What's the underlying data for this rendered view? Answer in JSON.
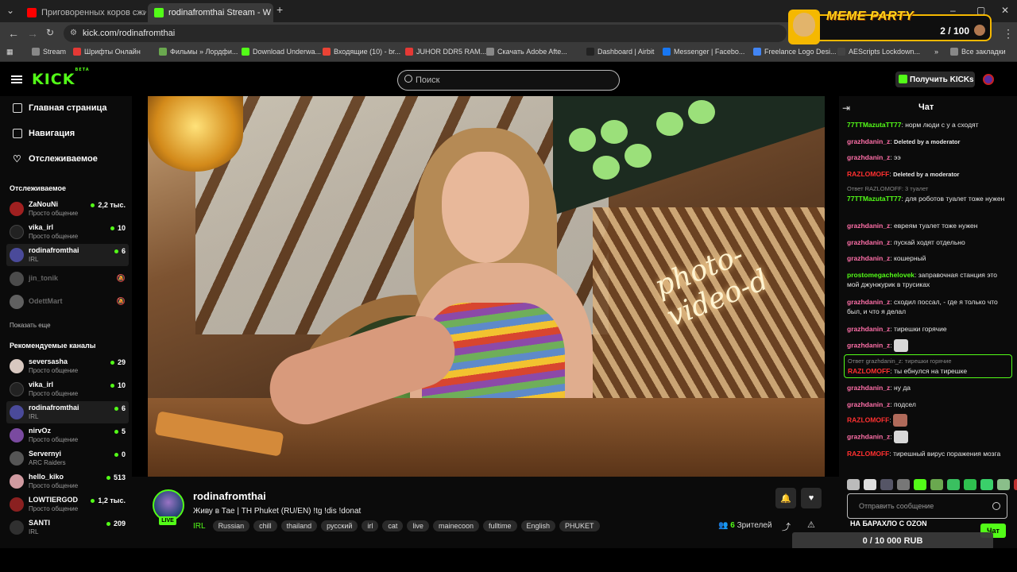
{
  "browser": {
    "tabs": [
      {
        "title": "Приговоренных коров сжига",
        "favicon_color": "#ff0000"
      },
      {
        "title": "rodinafromthai Stream - W",
        "favicon_color": "#53fc18",
        "active": true
      }
    ],
    "url": "kick.com/rodinafromthai",
    "bookmarks": [
      {
        "label": "Stream",
        "icon_color": "#888888"
      },
      {
        "label": "Шрифты Онлайн",
        "icon_color": "#e53935"
      },
      {
        "label": "Фильмы » Лордфи...",
        "icon_color": "#6aa84f"
      },
      {
        "label": "Download Underwa...",
        "icon_color": "#53fc18"
      },
      {
        "label": "Входящие (10) - br...",
        "icon_color": "#ea4335"
      },
      {
        "label": "JUHOR DDR5 RAM...",
        "icon_color": "#e53935"
      },
      {
        "label": "Скачать Adobe Afte...",
        "icon_color": "#888888"
      },
      {
        "label": "Dashboard | Airbit",
        "icon_color": "#222222"
      },
      {
        "label": "Messenger | Facebo...",
        "icon_color": "#1877f2"
      },
      {
        "label": "Freelance Logo Desi...",
        "icon_color": "#4285f4"
      },
      {
        "label": "AEScripts Lockdown...",
        "icon_color": "#444444"
      }
    ],
    "all_bookmarks": "Все закладки"
  },
  "overlay": {
    "meme_title": "MEME PARTY",
    "meme_count": "2 / 100",
    "goal": "0 / 10 000 RUB"
  },
  "header": {
    "logo": "KICK",
    "logo_badge": "BETA",
    "search_placeholder": "Поиск",
    "get_kicks": "Получить KICKs"
  },
  "sidebar": {
    "nav": [
      {
        "label": "Главная страница",
        "icon": "home-icon"
      },
      {
        "label": "Навигация",
        "icon": "browse-icon"
      },
      {
        "label": "Отслеживаемое",
        "icon": "heart-icon"
      }
    ],
    "following_title": "Отслеживаемое",
    "following": [
      {
        "name": "ZaNouNi",
        "category": "Просто общение",
        "viewers": "2,2 тыс.",
        "avatar_color": "#a02020"
      },
      {
        "name": "vika_irl",
        "category": "Просто общение",
        "viewers": "10",
        "avatar_color": "#222222"
      },
      {
        "name": "rodinafromthai",
        "category": "IRL",
        "viewers": "6",
        "avatar_color": "#4a4a9a",
        "selected": true
      },
      {
        "name": "jin_tonik",
        "offline": true,
        "avatar_color": "#777777"
      },
      {
        "name": "OdettMart",
        "offline": true,
        "avatar_color": "#999999"
      }
    ],
    "show_more": "Показать еще",
    "recommended_title": "Рекомендуемые каналы",
    "recommended": [
      {
        "name": "seversasha",
        "category": "Просто общение",
        "viewers": "29",
        "avatar_color": "#d8c8c0"
      },
      {
        "name": "vika_irl",
        "category": "Просто общение",
        "viewers": "10",
        "avatar_color": "#222222"
      },
      {
        "name": "rodinafromthai",
        "category": "IRL",
        "viewers": "6",
        "avatar_color": "#4a4a9a",
        "selected": true
      },
      {
        "name": "nirvOz",
        "category": "Просто общение",
        "viewers": "5",
        "avatar_color": "#7a4aa0"
      },
      {
        "name": "Servernyi",
        "category": "ARC Raiders",
        "viewers": "0",
        "avatar_color": "#555555"
      },
      {
        "name": "hello_kiko",
        "category": "Просто общение",
        "viewers": "513",
        "avatar_color": "#d09aa0"
      },
      {
        "name": "LOWTIERGOD",
        "category": "Просто общение",
        "viewers": "1,2 тыс.",
        "avatar_color": "#8a2020"
      },
      {
        "name": "SANTI",
        "category": "IRL",
        "viewers": "209",
        "avatar_color": "#303030"
      }
    ]
  },
  "stream": {
    "streamer": "rodinafromthai",
    "live_label": "LIVE",
    "title": "Живу в Тае | TH Phuket (RU/EN) !tg !dis !donat",
    "category": "IRL",
    "tags": [
      "Russian",
      "chill",
      "thailand",
      "русский",
      "irl",
      "cat",
      "live",
      "mainecoon",
      "fulltime",
      "English",
      "PHUKET"
    ],
    "viewers_count": "6",
    "viewers_label": "Зрителей"
  },
  "chat": {
    "title": "Чат",
    "messages": [
      {
        "user": "77TTMazutaTT77",
        "color": "#53fc18",
        "text": "норм люди с у а сходят"
      },
      {
        "user": "grazhdanin_z",
        "color": "#ff6fa8",
        "text": "Deleted by a moderator",
        "deleted": true
      },
      {
        "user": "grazhdanin_z",
        "color": "#ff6fa8",
        "text": "ээ"
      },
      {
        "user": "RAZLOMOFF",
        "color": "#ff3030",
        "text": "Deleted by a moderator",
        "deleted": true
      },
      {
        "reply": "Ответ RAZLOMOFF: 3 туалет",
        "user": "77TTMazutaTT77",
        "color": "#53fc18",
        "text": "для роботов туалет тоже нужен"
      },
      {
        "user": "grazhdanin_z",
        "color": "#ff6fa8",
        "text": "евреям туалет тоже нужен"
      },
      {
        "user": "grazhdanin_z",
        "color": "#ff6fa8",
        "text": "пускай ходят отдельно"
      },
      {
        "user": "grazhdanin_z",
        "color": "#ff6fa8",
        "text": "кошерный"
      },
      {
        "user": "prostomegachelovek",
        "color": "#53fc18",
        "text": "заправочная станция это мой джунжурик в трусиках"
      },
      {
        "user": "grazhdanin_z",
        "color": "#ff6fa8",
        "text": "сходил поссал, - где я только что был, и что я делал"
      },
      {
        "user": "grazhdanin_z",
        "color": "#ff6fa8",
        "text": "тирешки горячие"
      },
      {
        "user": "grazhdanin_z",
        "color": "#ff6fa8",
        "text": "",
        "emote": "cat-emote"
      },
      {
        "reply": "Ответ grazhdanin_z: тирешки горячие",
        "user": "RAZLOMOFF",
        "color": "#ff3030",
        "text": "ты ебнулся на тирешке",
        "highlight": true
      },
      {
        "user": "grazhdanin_z",
        "color": "#ff6fa8",
        "text": "ну да"
      },
      {
        "user": "grazhdanin_z",
        "color": "#ff6fa8",
        "text": "подсел"
      },
      {
        "user": "RAZLOMOFF",
        "color": "#ff3030",
        "text": "",
        "emote": "face-emote"
      },
      {
        "user": "grazhdanin_z",
        "color": "#ff6fa8",
        "text": "",
        "emote": "cat-emote"
      },
      {
        "user": "RAZLOMOFF",
        "color": "#ff3030",
        "text": "тирешный вирус поражения мозга"
      }
    ],
    "input_placeholder": "Отправить сообщение",
    "pinned_goal": "НА БАРАХЛО С OZON",
    "send_label": "Чат"
  }
}
